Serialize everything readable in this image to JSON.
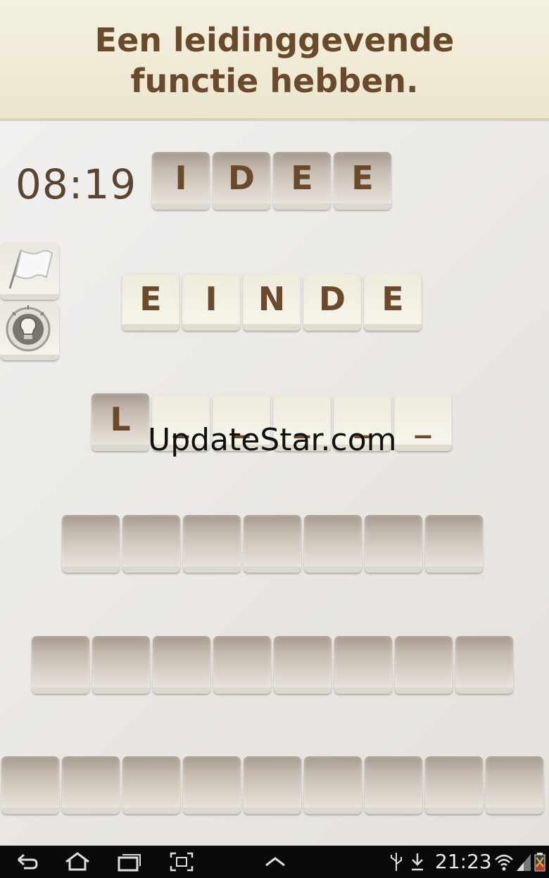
{
  "header": {
    "clue_line1": "Een leidinggevende",
    "clue_line2": "functie hebben."
  },
  "game": {
    "timer": "08:19",
    "row1": [
      "I",
      "D",
      "E",
      "E"
    ],
    "row2": [
      "E",
      "I",
      "N",
      "D",
      "E"
    ],
    "row3": [
      "L",
      "_",
      "_",
      "_",
      "_",
      "_"
    ]
  },
  "watermark": "UpdateStar.com",
  "status_bar": {
    "time": "21:23"
  },
  "icons": [
    "flag-icon",
    "lightbulb-icon",
    "back-icon",
    "home-icon",
    "recent-apps-icon",
    "screenshot-icon",
    "up-chevron-icon",
    "usb-icon",
    "download-icon",
    "wifi-icon",
    "signal-icon",
    "battery-icon"
  ]
}
